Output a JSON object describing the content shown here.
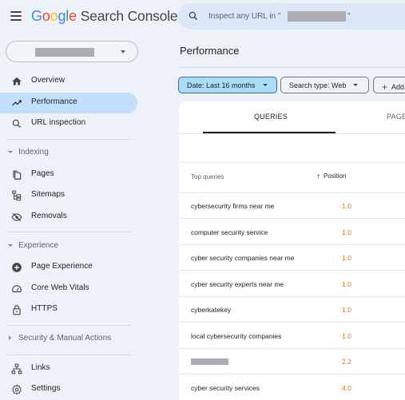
{
  "app": {
    "logo_google": [
      "G",
      "o",
      "o",
      "g",
      "l",
      "e"
    ],
    "logo_product": "Search Console",
    "property_selector": {
      "value": "[redacted]"
    }
  },
  "search": {
    "placeholder_prefix": "Inspect any URL in \"",
    "placeholder_property": "[redacted]",
    "placeholder_suffix": "\""
  },
  "sidebar": {
    "top_items": [
      {
        "label": "Overview",
        "icon": "home-icon"
      },
      {
        "label": "Performance",
        "icon": "trending-up-icon",
        "active": true
      },
      {
        "label": "URL inspection",
        "icon": "search-icon"
      }
    ],
    "sections": [
      {
        "label": "Indexing",
        "expanded": true,
        "items": [
          {
            "label": "Pages",
            "icon": "pages-icon"
          },
          {
            "label": "Sitemaps",
            "icon": "sitemap-icon"
          },
          {
            "label": "Removals",
            "icon": "eye-off-icon"
          }
        ]
      },
      {
        "label": "Experience",
        "expanded": true,
        "items": [
          {
            "label": "Page Experience",
            "icon": "page-experience-icon"
          },
          {
            "label": "Core Web Vitals",
            "icon": "speedometer-icon"
          },
          {
            "label": "HTTPS",
            "icon": "lock-icon"
          }
        ]
      },
      {
        "label": "Security & Manual Actions",
        "expanded": false,
        "items": []
      }
    ],
    "bottom_items": [
      {
        "label": "Links",
        "icon": "links-icon"
      },
      {
        "label": "Settings",
        "icon": "gear-icon"
      }
    ]
  },
  "main": {
    "title": "Performance",
    "filters": [
      {
        "label": "Date: Last 16 months",
        "active": true
      },
      {
        "label": "Search type: Web",
        "active": false
      },
      {
        "label": "Add",
        "type": "add"
      }
    ],
    "tabs": [
      {
        "label": "QUERIES",
        "active": true
      },
      {
        "label": "PAGE",
        "active": false
      }
    ],
    "table": {
      "columns": [
        "Top queries",
        "Position"
      ],
      "sort": {
        "column": "Position",
        "direction": "ascending"
      },
      "rows": [
        {
          "query": "cybersecurity firms near me",
          "position": "1.0"
        },
        {
          "query": "computer security service",
          "position": "1.0"
        },
        {
          "query": "cyber security companies near me",
          "position": "1.0"
        },
        {
          "query": "cyber security experts near me",
          "position": "1.0"
        },
        {
          "query": "cyberkatekey",
          "position": "1.0"
        },
        {
          "query": "local cybersecurity companies",
          "position": "1.0"
        },
        {
          "query": "",
          "redacted": true,
          "position": "2.2"
        },
        {
          "query": "cyber security services",
          "position": "4.0"
        }
      ]
    }
  },
  "colors": {
    "background": "#edf2f9",
    "active_nav": "#c2e0fb",
    "active_chip": "#a8dcf7",
    "position_value": "#e37400"
  }
}
